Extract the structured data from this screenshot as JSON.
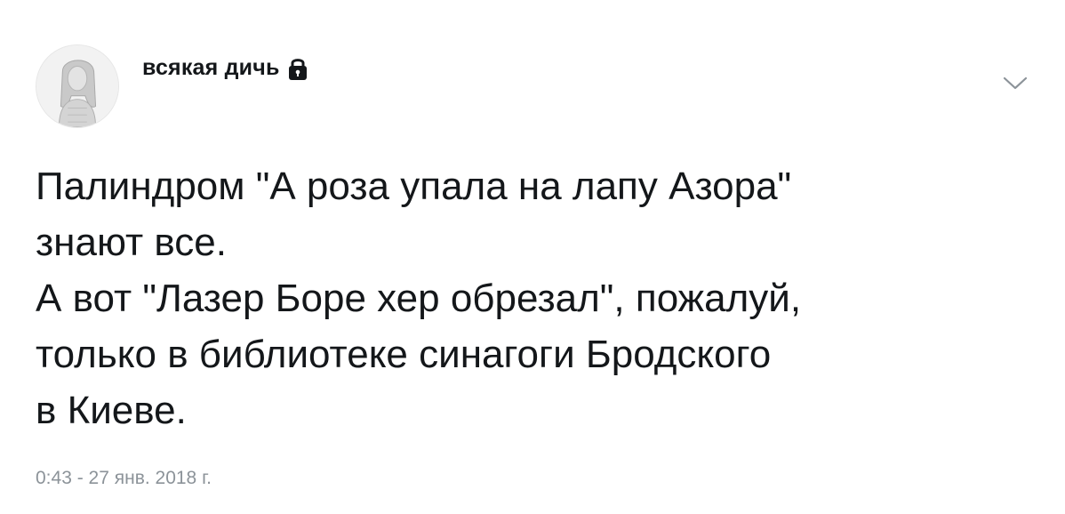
{
  "user": {
    "display_name": "всякая дичь",
    "protected_icon": "lock-icon",
    "avatar_icon": "avatar"
  },
  "menu": {
    "icon": "chevron-down-icon"
  },
  "tweet": {
    "lines": [
      "Палиндром \"А роза упала на лапу Азора\"",
      "знают все.",
      "А вот \"Лазер Боре хер обрезал\", пожалуй,",
      "только в библиотеке синагоги Бродского",
      "в Киеве."
    ],
    "timestamp": "0:43 - 27 янв. 2018 г."
  },
  "colors": {
    "text": "#14171a",
    "muted": "#8c9399",
    "background": "#ffffff"
  }
}
